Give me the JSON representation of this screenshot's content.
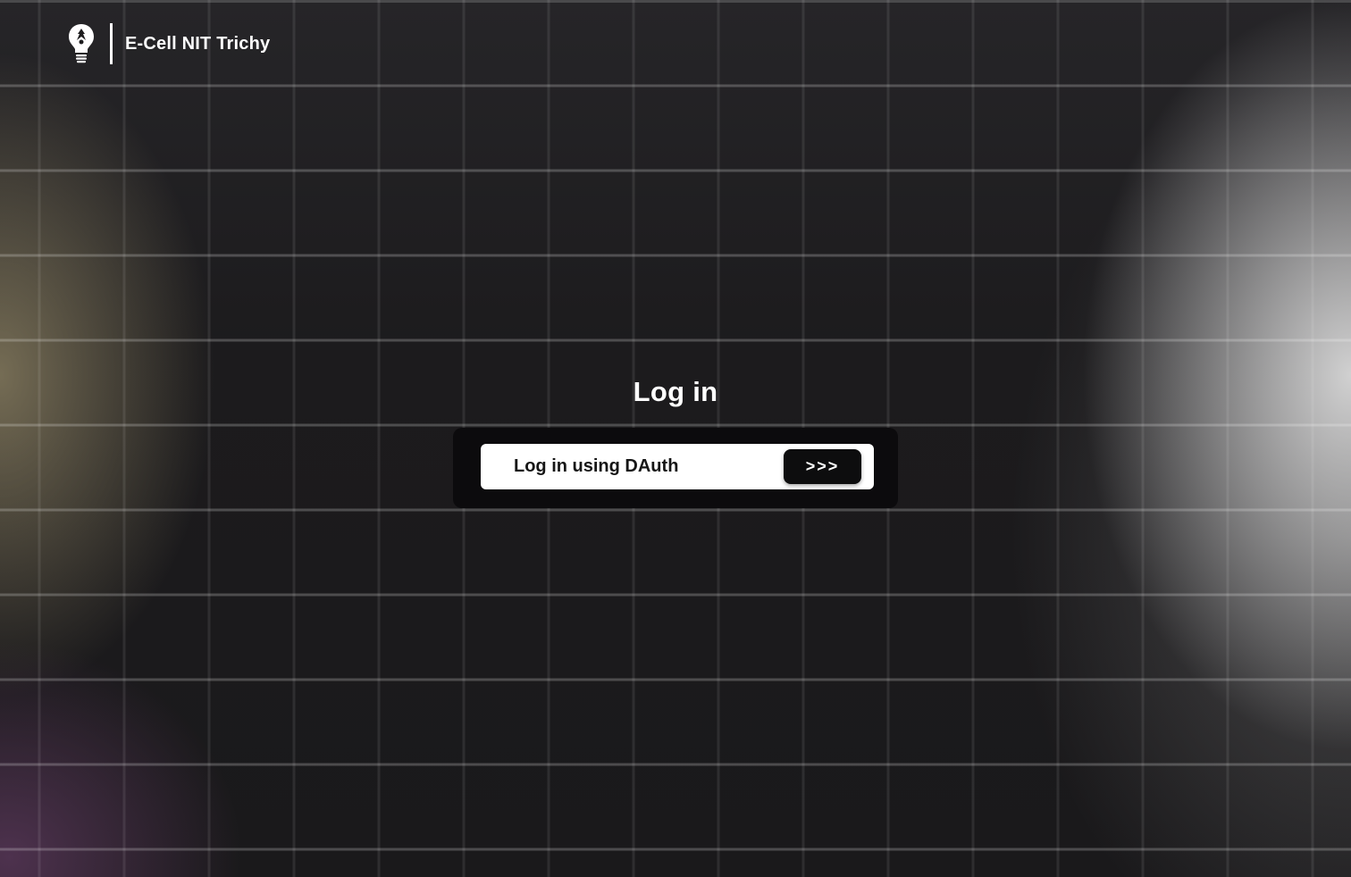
{
  "header": {
    "logo_icon": "lightbulb-logo-icon",
    "brand_name": "E-Cell NIT Trichy"
  },
  "login": {
    "title": "Log in",
    "dauth_label": "Log in using DAuth",
    "go_button_label": ">>>"
  },
  "colors": {
    "background": "#1d1c1e",
    "panel": "#0c0b0d",
    "row": "#ffffff",
    "button": "#0d0d0e",
    "text_light": "#ffffff",
    "text_dark": "#161616"
  }
}
